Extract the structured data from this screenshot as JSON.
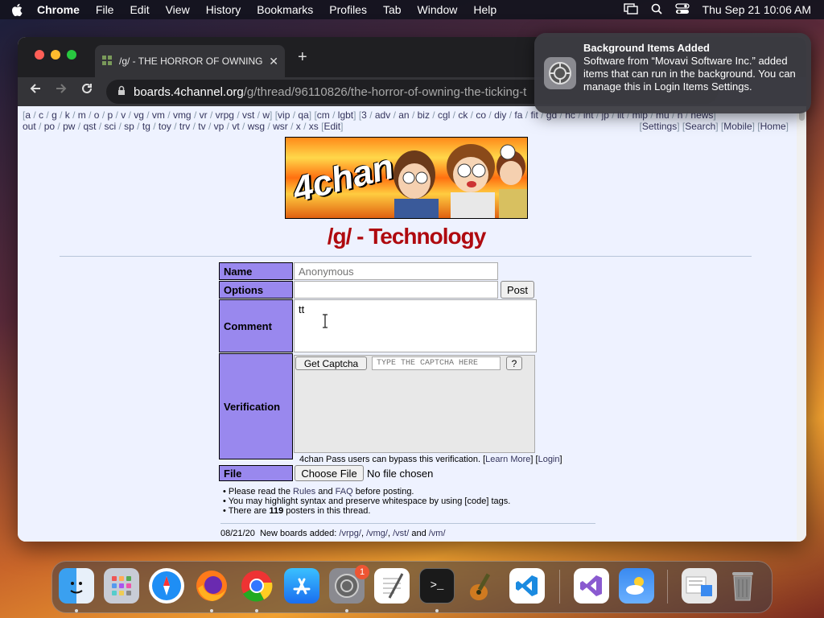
{
  "menubar": {
    "items": [
      "Chrome",
      "File",
      "Edit",
      "View",
      "History",
      "Bookmarks",
      "Profiles",
      "Tab",
      "Window",
      "Help"
    ],
    "datetime": "Thu Sep 21  10:06 AM"
  },
  "browser": {
    "tab_title": "/g/ - THE HORROR OF OWNING",
    "url_host": "boards.4channel.org",
    "url_path": "/g/thread/96110826/the-horror-of-owning-the-ticking-t"
  },
  "board_nav": {
    "line1": [
      "a",
      "c",
      "g",
      "k",
      "m",
      "o",
      "p",
      "v",
      "vg",
      "vm",
      "vmg",
      "vr",
      "vrpg",
      "vst",
      "w"
    ],
    "line1_group2": [
      "vip",
      "qa"
    ],
    "line1_group3": [
      "cm",
      "lgbt"
    ],
    "line1_group4": [
      "3",
      "adv",
      "an",
      "biz",
      "cgl",
      "ck",
      "co",
      "diy",
      "fa",
      "fit",
      "gd",
      "hc",
      "int",
      "jp",
      "lit",
      "mlp",
      "mu",
      "n",
      "news"
    ],
    "line2": [
      "out",
      "po",
      "pw",
      "qst",
      "sci",
      "sp",
      "tg",
      "toy",
      "trv",
      "tv",
      "vp",
      "vt",
      "wsg",
      "wsr",
      "x",
      "xs"
    ],
    "edit": "Edit",
    "right_links": [
      "Settings",
      "Search",
      "Mobile",
      "Home"
    ]
  },
  "board": {
    "banner_logo": "4chan",
    "title": "/g/ - Technology"
  },
  "form": {
    "name_label": "Name",
    "name_placeholder": "Anonymous",
    "options_label": "Options",
    "post_button": "Post",
    "comment_label": "Comment",
    "comment_value": "tt",
    "verification_label": "Verification",
    "get_captcha_button": "Get Captcha",
    "captcha_placeholder": "TYPE THE CAPTCHA HERE",
    "captcha_help_button": "?",
    "pass_text": "4chan Pass users can bypass this verification.",
    "learn_more": "Learn More",
    "login": "Login",
    "file_label": "File",
    "choose_file_button": "Choose File",
    "no_file_text": "No file chosen"
  },
  "rules": {
    "line1_pre": "• Please read the",
    "rules_link": "Rules",
    "and": "and",
    "faq_link": "FAQ",
    "line1_post": "before posting.",
    "line2": "• You may highlight syntax and preserve whitespace by using [code] tags.",
    "line3_pre": "• There are",
    "posters_count": "119",
    "line3_post": "posters in this thread."
  },
  "news": {
    "date": "08/21/20",
    "text": "New boards added:",
    "boards": [
      "/vrpg/",
      "/vmg/",
      "/vst/"
    ],
    "and": "and",
    "last_board": "/vm/"
  },
  "notification": {
    "title": "Background Items Added",
    "body": "Software from “Movavi Software Inc.” added items that can run in the background. You can manage this in Login Items Settings."
  },
  "dock": {
    "apps": [
      "Finder",
      "Launchpad",
      "Safari",
      "Firefox",
      "Chrome",
      "App Store",
      "System Settings",
      "TextEdit",
      "Terminal",
      "GarageBand",
      "Visual Studio Code",
      "Visual Studio",
      "Weather",
      "Preview",
      "Trash"
    ],
    "settings_badge": "1"
  }
}
